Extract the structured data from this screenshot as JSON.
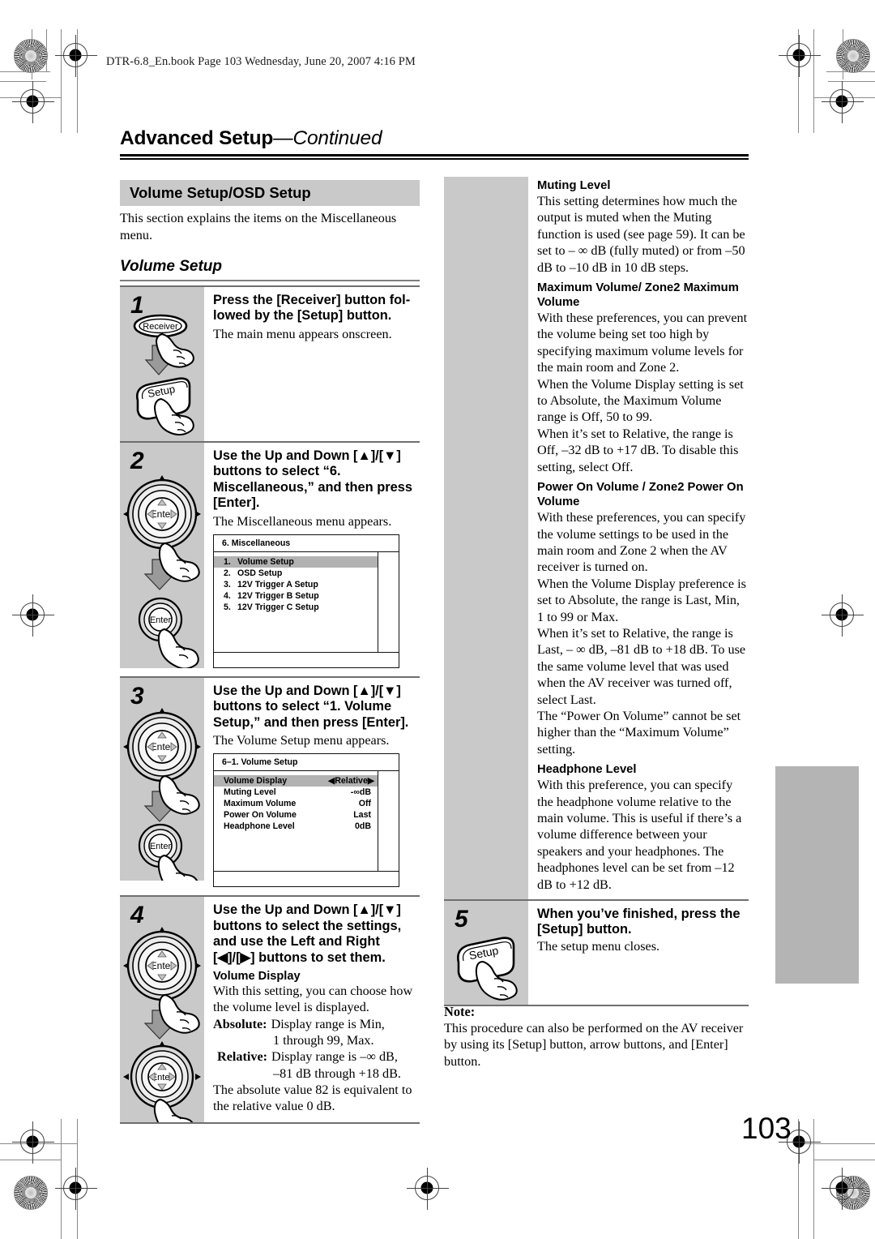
{
  "print_marks": {
    "file_stamp": "DTR-6.8_En.book  Page 103  Wednesday, June 20, 2007  4:16 PM"
  },
  "header": {
    "chapter": "Advanced Setup",
    "continued": "—Continued"
  },
  "section": {
    "banner": "Volume Setup/OSD Setup",
    "intro": "This section explains the items on the Miscellaneous menu.",
    "subhead": "Volume Setup"
  },
  "steps": [
    {
      "num": "1",
      "head": "Press the [Receiver] button fol-lowed by the [Setup] button.",
      "sub": "The main menu appears onscreen.",
      "buttons": [
        "Receiver",
        "Setup"
      ]
    },
    {
      "num": "2",
      "head": "Use the Up and Down [▲]/[▼] buttons to select “6. Miscellaneous,” and then press [Enter].",
      "sub": "The Miscellaneous menu appears.",
      "buttons": [
        "Enter",
        "Enter"
      ],
      "osd": {
        "title": "6.  Miscellaneous",
        "rows": [
          {
            "idx": "1.",
            "name": "Volume Setup",
            "selected": true
          },
          {
            "idx": "2.",
            "name": "OSD Setup",
            "selected": false
          },
          {
            "idx": "3.",
            "name": "12V Trigger A Setup",
            "selected": false
          },
          {
            "idx": "4.",
            "name": "12V Trigger B Setup",
            "selected": false
          },
          {
            "idx": "5.",
            "name": "12V Trigger C Setup",
            "selected": false
          }
        ]
      }
    },
    {
      "num": "3",
      "head": "Use the Up and Down [▲]/[▼] buttons to select “1. Volume Setup,” and then press [Enter].",
      "sub": "The Volume Setup menu appears.",
      "buttons": [
        "Enter",
        "Enter"
      ],
      "osd": {
        "title": "6–1.  Volume Setup",
        "rows": [
          {
            "name": "Volume Display",
            "value": "Relative",
            "selected": true,
            "arrows": true
          },
          {
            "name": "Muting Level",
            "value": "-∞dB",
            "selected": false
          },
          {
            "name": "Maximum Volume",
            "value": "Off",
            "selected": false
          },
          {
            "name": "Power On Volume",
            "value": "Last",
            "selected": false
          },
          {
            "name": "Headphone Level",
            "value": "0dB",
            "selected": false
          }
        ]
      }
    },
    {
      "num": "4",
      "head": "Use the Up and Down [▲]/[▼] buttons to select the settings, and use the Left and Right [◀]/[▶] buttons to set them.",
      "sub_heading": "Volume Display",
      "sub_body": "With this setting, you can choose how the volume level is displayed.",
      "defs": [
        {
          "term": "Absolute:",
          "text": "Display range is Min,",
          "cont": "1 through 99, Max."
        },
        {
          "term": "Relative:",
          "text": "Display range is –∞ dB,",
          "cont": "–81 dB through +18 dB."
        }
      ],
      "tail": "The absolute value 82 is equivalent to the relative value 0 dB.",
      "buttons": [
        "Enter",
        "Enter"
      ]
    }
  ],
  "right_column": {
    "blocks": [
      {
        "heading": "Muting Level",
        "paras": [
          "This setting determines how much the output is muted when the Muting function is used (see page 59). It can be set to – ∞ dB (fully muted) or from –50 dB to –10 dB in 10 dB steps."
        ]
      },
      {
        "heading": "Maximum Volume/ Zone2 Maximum Volume",
        "paras": [
          "With these preferences, you can prevent the volume being set too high by specifying maximum volume levels for the main room and Zone 2.",
          "When the Volume Display setting is set to Absolute, the Maximum Volume range is Off, 50 to 99.",
          "When it’s set to Relative, the range is Off, –32 dB to +17 dB. To disable this setting, select Off."
        ]
      },
      {
        "heading": "Power On Volume / Zone2 Power On Volume",
        "paras": [
          "With these preferences, you can specify the volume settings to be used in the main room and Zone 2 when the AV receiver is turned on.",
          "When the Volume Display preference is set to Absolute, the range is Last, Min, 1 to 99 or Max.",
          "When it’s set to Relative, the range is Last, – ∞ dB, –81 dB to +18 dB. To use the same volume level that was used when the AV receiver was turned off, select Last.",
          "The “Power On Volume” cannot be set higher than the “Maximum Volume” setting."
        ]
      },
      {
        "heading": "Headphone Level",
        "paras": [
          "With this preference, you can specify the headphone volume relative to the main volume. This is useful if there’s a volume difference between your speakers and your headphones. The headphones level can be set from –12 dB to +12 dB."
        ]
      }
    ],
    "step5": {
      "num": "5",
      "head": "When you’ve finished, press the [Setup] button.",
      "sub": "The setup menu closes.",
      "buttons": [
        "Setup"
      ]
    }
  },
  "note": {
    "label": "Note:",
    "text": "This procedure can also be performed on the AV receiver by using its [Setup] button, arrow buttons, and [Enter] button."
  },
  "page_number": "103",
  "colors": {
    "gray_panel": "#c9c9c9",
    "tab_gray": "#b4b4b4",
    "osd_highlight": "#b2b2b2",
    "rule": "#6f6f6f"
  }
}
